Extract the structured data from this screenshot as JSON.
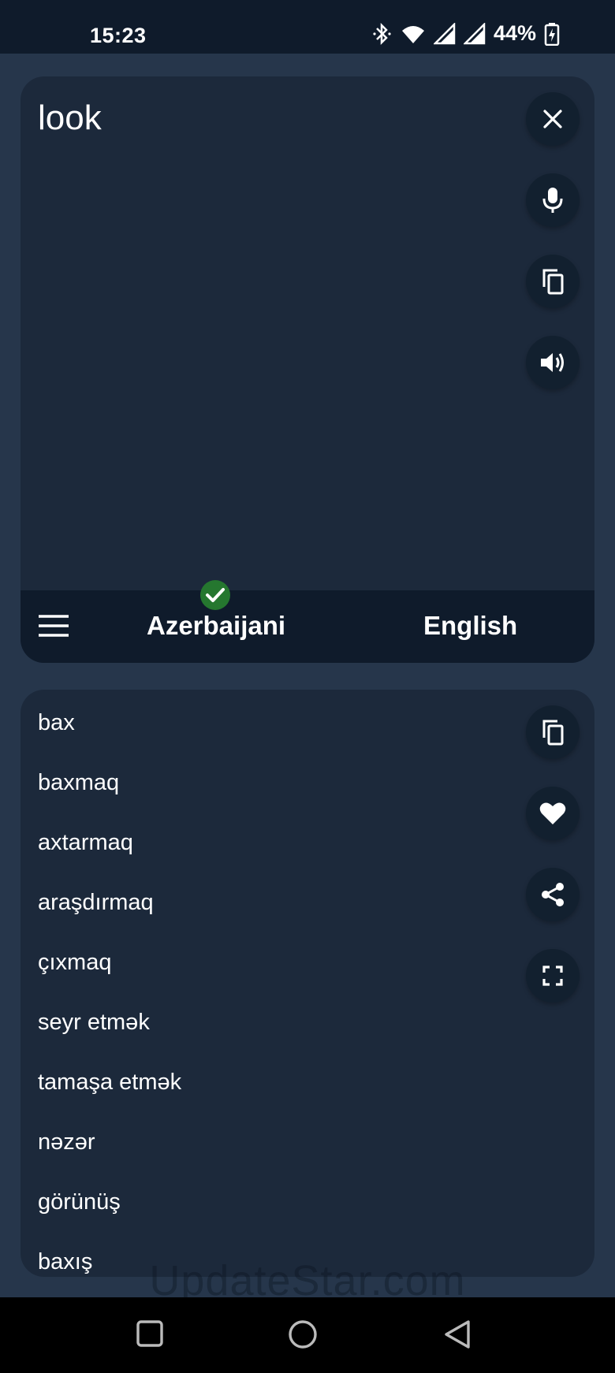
{
  "status_bar": {
    "time": "15:23",
    "battery": "44%",
    "icons": [
      "bluetooth-icon",
      "wifi-icon",
      "signal-icon",
      "signal-icon",
      "battery-charging-icon"
    ]
  },
  "input": {
    "text": "look",
    "actions": [
      "close-icon",
      "microphone-icon",
      "copy-icon",
      "speaker-icon"
    ]
  },
  "language_bar": {
    "source": "Azerbaijani",
    "target": "English"
  },
  "output": {
    "results": [
      "bax",
      "baxmaq",
      "axtarmaq",
      "araşdırmaq",
      "çıxmaq",
      "seyr etmək",
      "tamaşa etmək",
      "nəzər",
      "görünüş",
      "baxış"
    ],
    "actions": [
      "copy-icon",
      "heart-icon",
      "share-icon",
      "fullscreen-icon"
    ]
  },
  "watermark": "UpdateStar.com",
  "colors": {
    "background": "#26364b",
    "card": "#1c293b",
    "bar": "#0f1b2b",
    "check": "#25772f"
  }
}
